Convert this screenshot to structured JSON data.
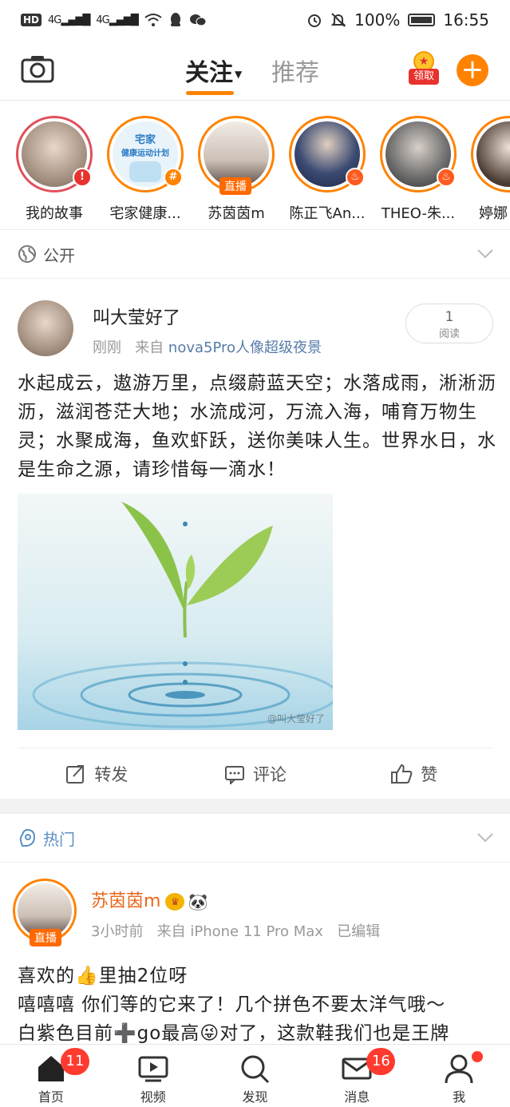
{
  "status_bar": {
    "hd": "HD",
    "net1": "4G",
    "net2": "4G",
    "battery": "100%",
    "time": "16:55"
  },
  "top_nav": {
    "tab_follow": "关注",
    "tab_recommend": "推荐",
    "claim_label": "领取"
  },
  "stories": [
    {
      "name": "我的故事"
    },
    {
      "name": "宅家健康...",
      "badge_title": "宅家",
      "badge_sub": "健康运动计划"
    },
    {
      "name": "苏茵茵m",
      "live": "直播"
    },
    {
      "name": "陈正飞An..."
    },
    {
      "name": "THEO-朱..."
    },
    {
      "name": "婷娜"
    }
  ],
  "section_public": {
    "label": "公开"
  },
  "post1": {
    "name": "叫大莹好了",
    "time": "刚刚",
    "from": "来自",
    "source": "nova5Pro人像超级夜景",
    "read_count": "1",
    "read_label": "阅读",
    "text": "水起成云，遨游万里，点缀蔚蓝天空；水落成雨，淅淅沥沥，滋润苍茫大地；水流成河，万流入海，哺育万物生灵；水聚成海，鱼欢虾跃，送你美味人生。世界水日，水是生命之源，请珍惜每一滴水！",
    "watermark": "@叫大莹好了"
  },
  "actions": {
    "repost": "转发",
    "comment": "评论",
    "like": "赞"
  },
  "section_hot": {
    "label": "热门"
  },
  "post2": {
    "name": "苏茵茵m",
    "live": "直播",
    "time": "3小时前",
    "from": "来自",
    "source": "iPhone 11 Pro Max",
    "edited": "已编辑",
    "line1": "喜欢的👍里抽2位呀",
    "line2": "嘻嘻嘻 你们等的它来了！几个拼色不要太洋气哦～",
    "line3": "白紫色目前➕go最高😜对了，这款鞋我们也是王牌"
  },
  "tabbar": {
    "home": "首页",
    "home_badge": "11",
    "video": "视频",
    "discover": "发现",
    "messages": "消息",
    "messages_badge": "16",
    "me": "我"
  },
  "colors": {
    "accent": "#ff8200",
    "link": "#577ca8",
    "badge": "#ff3b30",
    "hot_name": "#e8671c"
  }
}
